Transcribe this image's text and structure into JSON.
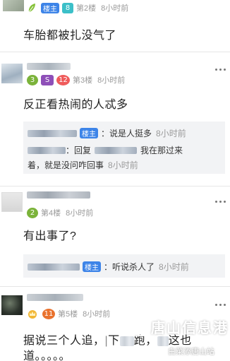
{
  "colors": {
    "accent": "#3d84e8",
    "muted": "#9a9a9a",
    "reply_bg": "#f2f3f5"
  },
  "posts": [
    {
      "floor": "第2楼",
      "time": "8小时前",
      "badges": [
        {
          "icon": "leaf-level-icon"
        },
        {
          "text": "楼主",
          "color": "#3d84e8"
        },
        {
          "text": "8",
          "color": "#3bbfc8"
        }
      ],
      "content": "车胎都被扎没气了"
    },
    {
      "floor": "第3楼",
      "time": "8小时前",
      "badges": [
        {
          "text": "3",
          "color": "#7bb33a"
        },
        {
          "text": "S",
          "color": "#8e4fb8"
        },
        {
          "text": "12",
          "color": "#ef5b5b"
        }
      ],
      "content": "反正看热闹的人忒多",
      "replies": [
        {
          "is_op": true,
          "label": "楼主",
          "text": "：说是人挺多",
          "time": "8小时前"
        },
        {
          "prefix": "：回复",
          "text": "我在那过来",
          "text2": "着，就是没问咋回事",
          "time": "8小时前"
        }
      ]
    },
    {
      "floor": "第4楼",
      "time": "8小时前",
      "badges": [
        {
          "text": "2",
          "color": "#7bb33a"
        }
      ],
      "content": "有出事了?",
      "replies": [
        {
          "is_op": true,
          "label": "楼主",
          "text": "：听说杀人了",
          "time": "8小时前"
        }
      ]
    },
    {
      "floor": "第5楼",
      "time": "8小时前",
      "badges": [
        {
          "icon": "crown-level-icon"
        },
        {
          "text": "11",
          "color": "#e9722e"
        }
      ],
      "content_parts": [
        "据说三个人追，",
        "下",
        "跑，",
        "这也",
        "道。。。。。"
      ]
    }
  ],
  "watermark": {
    "big": "唐山信息港",
    "small": "白菜添唐山站"
  }
}
